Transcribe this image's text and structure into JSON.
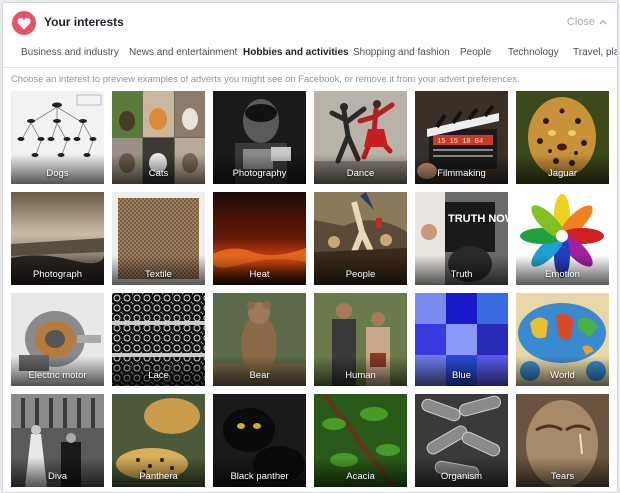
{
  "header": {
    "title": "Your interests",
    "close_label": "Close",
    "icon": "heart-icon",
    "accent_color": "#e9506a"
  },
  "tabs": [
    {
      "label": "Business and industry",
      "active": false
    },
    {
      "label": "News and entertainment",
      "active": false
    },
    {
      "label": "Hobbies and activities",
      "active": true
    },
    {
      "label": "Shopping and fashion",
      "active": false
    },
    {
      "label": "People",
      "active": false
    },
    {
      "label": "Technology",
      "active": false
    },
    {
      "label": "Travel, places",
      "active": false
    }
  ],
  "description": "Choose an interest to preview examples of adverts you might see on Facebook, or remove it from your advert preferences.",
  "interests": [
    {
      "label": "Dogs"
    },
    {
      "label": "Cats"
    },
    {
      "label": "Photography"
    },
    {
      "label": "Dance"
    },
    {
      "label": "Filmmaking"
    },
    {
      "label": "Jaguar"
    },
    {
      "label": "Photograph"
    },
    {
      "label": "Textile"
    },
    {
      "label": "Heat"
    },
    {
      "label": "People"
    },
    {
      "label": "Truth"
    },
    {
      "label": "Emotion"
    },
    {
      "label": "Electric motor"
    },
    {
      "label": "Lace"
    },
    {
      "label": "Bear"
    },
    {
      "label": "Human"
    },
    {
      "label": "Blue"
    },
    {
      "label": "World"
    },
    {
      "label": "Diva"
    },
    {
      "label": "Panthera"
    },
    {
      "label": "Black panther"
    },
    {
      "label": "Acacia"
    },
    {
      "label": "Organism"
    },
    {
      "label": "Tears"
    }
  ],
  "tile_texts": {
    "truth_sign": "TRUTH NOW",
    "film_numbers": "15 15 10 04"
  }
}
